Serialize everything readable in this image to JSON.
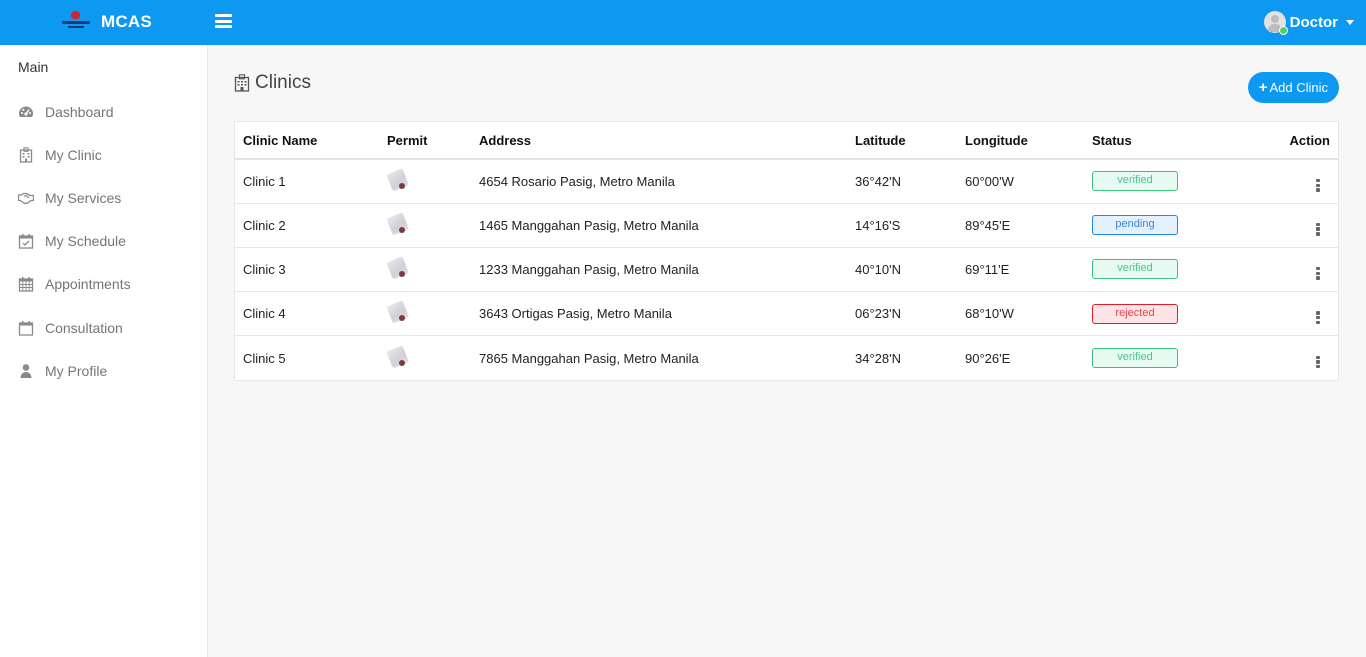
{
  "header": {
    "app_name": "MCAS",
    "user_name": "Doctor",
    "brand_color": "#0d99f2"
  },
  "sidebar": {
    "section_title": "Main",
    "items": [
      {
        "label": "Dashboard",
        "icon": "dashboard-icon"
      },
      {
        "label": "My Clinic",
        "icon": "hospital-icon"
      },
      {
        "label": "My Services",
        "icon": "handshake-icon"
      },
      {
        "label": "My Schedule",
        "icon": "calendar-check-icon"
      },
      {
        "label": "Appointments",
        "icon": "calendar-grid-icon"
      },
      {
        "label": "Consultation",
        "icon": "calendar-icon"
      },
      {
        "label": "My Profile",
        "icon": "user-icon"
      }
    ]
  },
  "page": {
    "title": "Clinics",
    "add_button_label": "Add Clinic"
  },
  "table": {
    "columns": [
      "Clinic Name",
      "Permit",
      "Address",
      "Latitude",
      "Longitude",
      "Status",
      "Action"
    ],
    "rows": [
      {
        "name": "Clinic 1",
        "address": "4654 Rosario Pasig, Metro Manila",
        "latitude": "36°42'N",
        "longitude": "60°00'W",
        "status": "verified"
      },
      {
        "name": "Clinic 2",
        "address": "1465 Manggahan Pasig, Metro Manila",
        "latitude": "14°16'S",
        "longitude": "89°45'E",
        "status": "pending"
      },
      {
        "name": "Clinic 3",
        "address": "1233 Manggahan Pasig, Metro Manila",
        "latitude": "40°10'N",
        "longitude": "69°11'E",
        "status": "verified"
      },
      {
        "name": "Clinic 4",
        "address": "3643 Ortigas Pasig, Metro Manila",
        "latitude": "06°23'N",
        "longitude": "68°10'W",
        "status": "rejected"
      },
      {
        "name": "Clinic 5",
        "address": "7865 Manggahan Pasig, Metro Manila",
        "latitude": "34°28'N",
        "longitude": "90°26'E",
        "status": "verified"
      }
    ]
  },
  "status_colors": {
    "verified": "#38c17a",
    "pending": "#1e8ae0",
    "rejected": "#e01d2a"
  }
}
